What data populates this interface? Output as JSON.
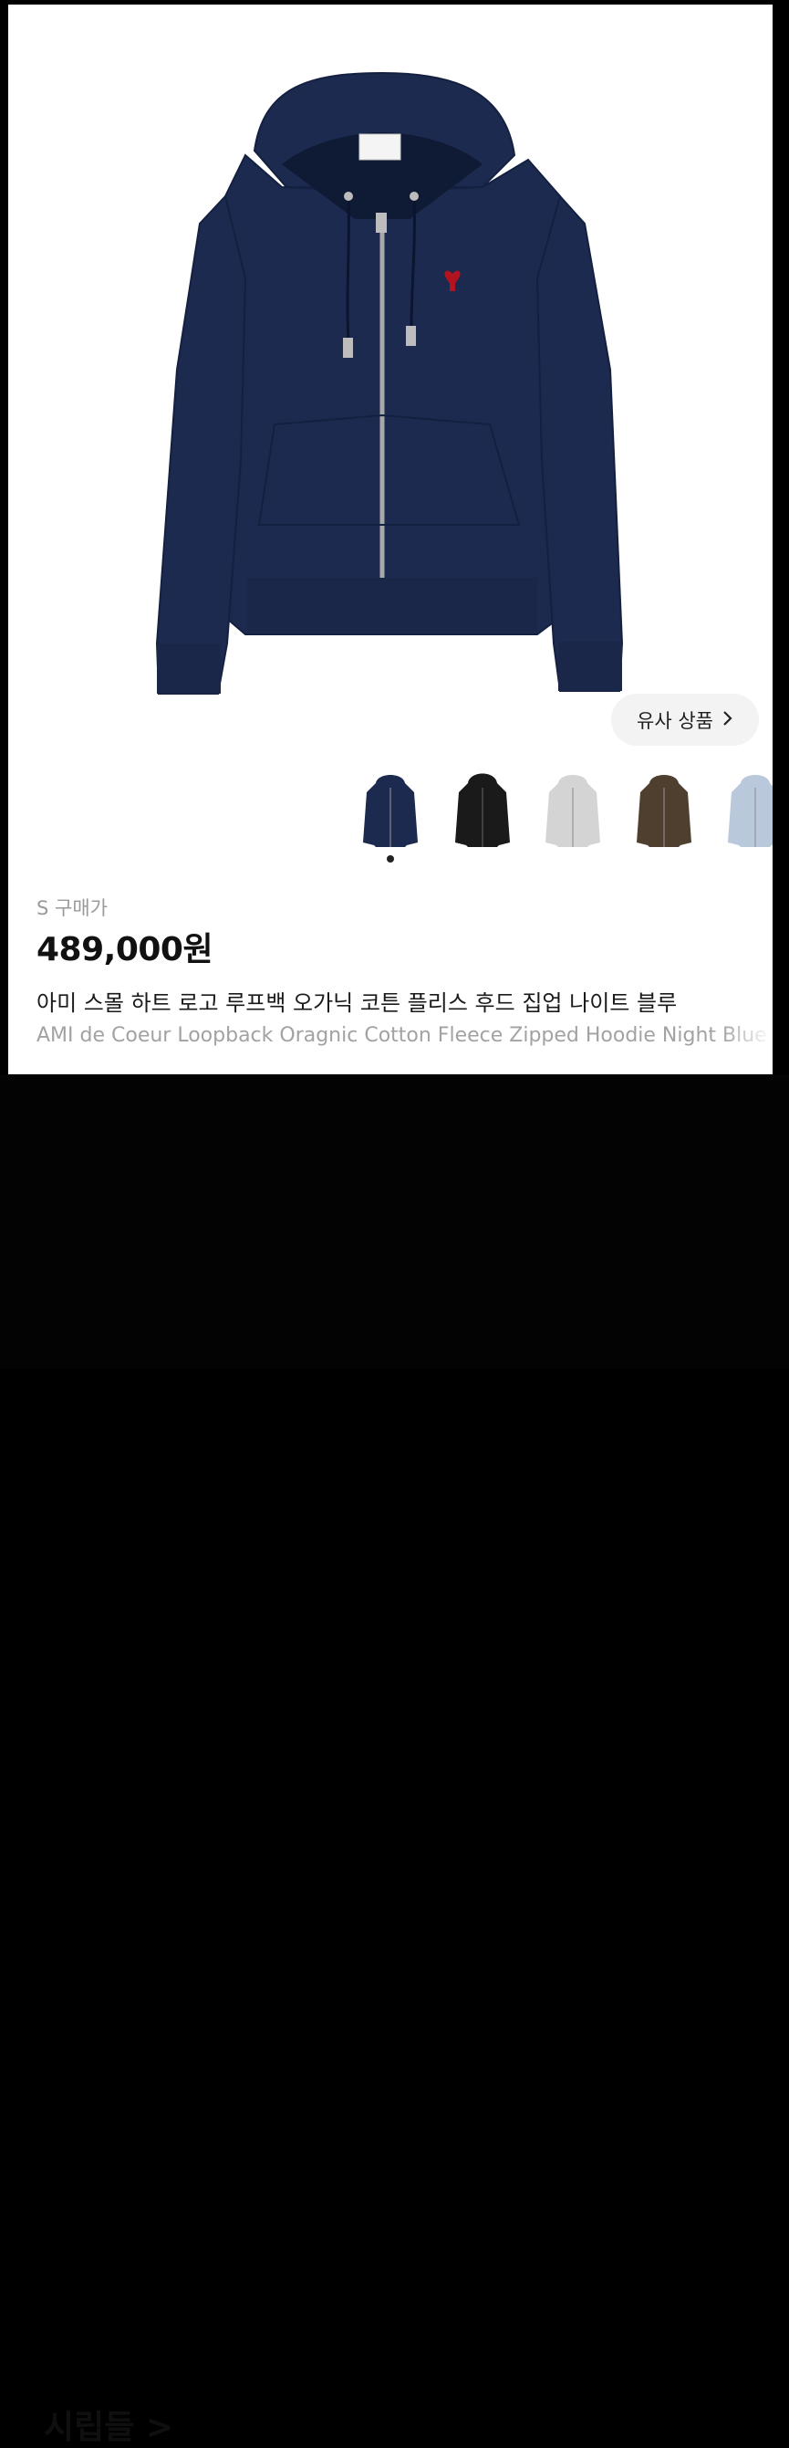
{
  "product": {
    "similar_button_label": "유사 상품",
    "size_label": "S 구매가",
    "price": "489,000원",
    "title_ko": "아미 스몰 하트 로고 루프백 오가닉 코튼 플리스 후드 집업 나이트 블루",
    "title_en": "AMI de Coeur Loopback Oragnic Cotton Fleece Zipped Hoodie Night Blue"
  },
  "colors": {
    "hoodie_navy": "#1c2a4f",
    "hoodie_black": "#1a1a1a",
    "hoodie_grey": "#d4d4d4",
    "hoodie_brown": "#4e3f2e",
    "hoodie_lightblue": "#b9c8db",
    "logo_red": "#b3121f"
  },
  "icons": [
    "chevron-right-icon",
    "heart-logo-icon"
  ],
  "background": {
    "heading": "시립들 >"
  }
}
